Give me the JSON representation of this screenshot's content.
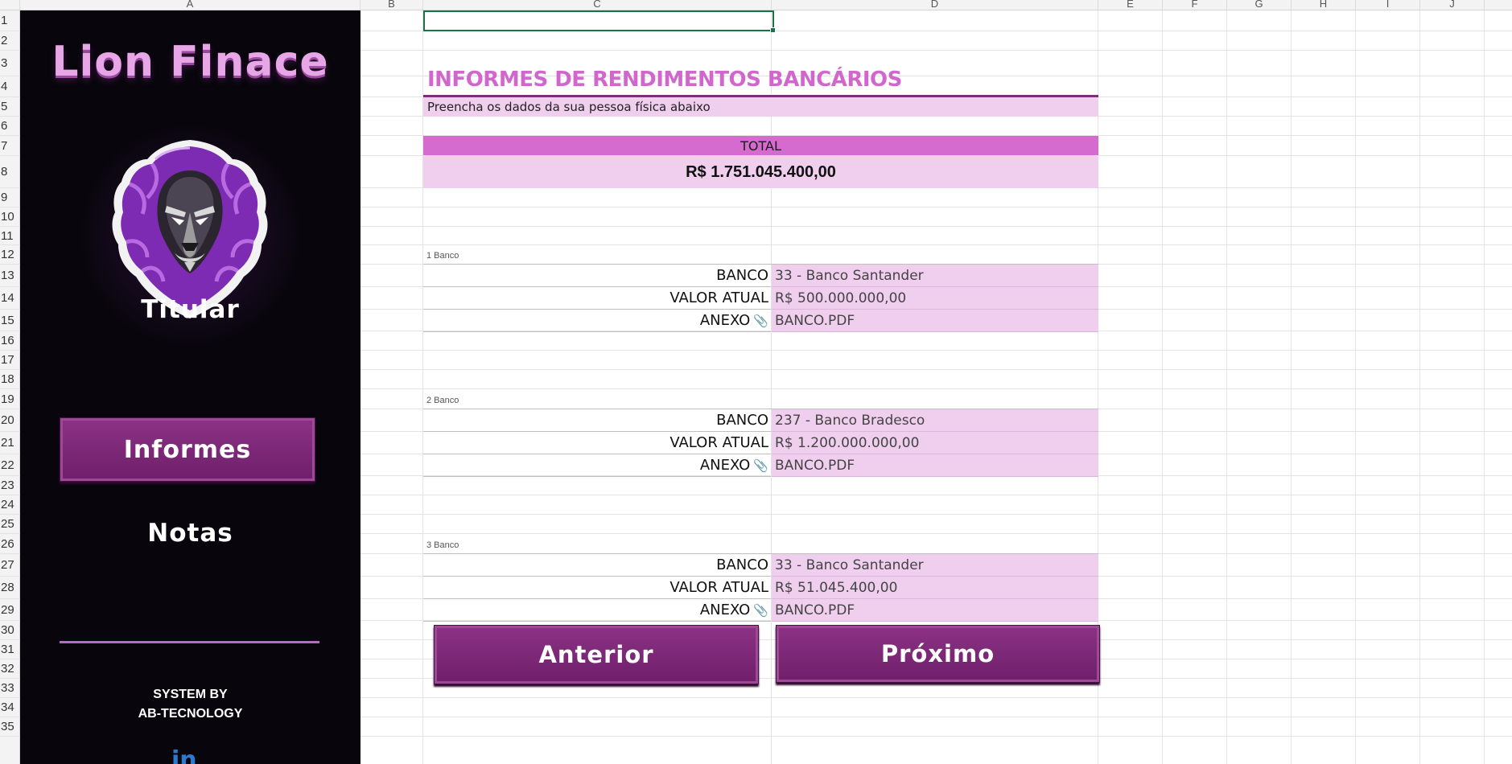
{
  "columns": [
    "A",
    "B",
    "C",
    "D",
    "E",
    "F",
    "G",
    "H",
    "I",
    "J"
  ],
  "rows": [
    "1",
    "2",
    "3",
    "4",
    "5",
    "6",
    "7",
    "8",
    "9",
    "10",
    "11",
    "12",
    "13",
    "14",
    "15",
    "16",
    "17",
    "18",
    "19",
    "20",
    "21",
    "22",
    "23",
    "24",
    "25",
    "26",
    "27",
    "28",
    "29",
    "30",
    "31",
    "32",
    "33",
    "34",
    "35"
  ],
  "sidebar": {
    "brand": "Lion Finace",
    "nav": {
      "titular": "Titular",
      "informes": "Informes",
      "notas": "Notas"
    },
    "system_line1": "SYSTEM BY",
    "system_line2": "AB-TECNOLOGY",
    "linkedin_glyph": "in",
    "accent_color": "#7b2473"
  },
  "form": {
    "title": "INFORMES DE RENDIMENTOS BANCÁRIOS",
    "subtitle": "Preencha os dados da sua pessoa física abaixo",
    "total_label": "TOTAL",
    "total_value": "R$ 1.751.045.400,00",
    "groups": [
      {
        "header": "1 Banco",
        "banco_label": "BANCO",
        "banco_value": "33 - Banco Santander",
        "valor_label": "VALOR ATUAL",
        "valor_value": "R$ 500.000.000,00",
        "anexo_label": "ANEXO",
        "anexo_value": "BANCO.PDF"
      },
      {
        "header": "2 Banco",
        "banco_label": "BANCO",
        "banco_value": "237 - Banco Bradesco",
        "valor_label": "VALOR ATUAL",
        "valor_value": "R$ 1.200.000.000,00",
        "anexo_label": "ANEXO",
        "anexo_value": "BANCO.PDF"
      },
      {
        "header": "3 Banco",
        "banco_label": "BANCO",
        "banco_value": "33 - Banco Santander",
        "valor_label": "VALOR ATUAL",
        "valor_value": "R$ 51.045.400,00",
        "anexo_label": "ANEXO",
        "anexo_value": "BANCO.PDF"
      }
    ],
    "prev_label": "Anterior",
    "next_label": "Próximo"
  },
  "colors": {
    "title_pink": "#d167cd",
    "cell_fill": "#f0cfee",
    "total_header": "#d56acf",
    "button_purple": "#7b2473",
    "selection_green": "#1e7145"
  }
}
